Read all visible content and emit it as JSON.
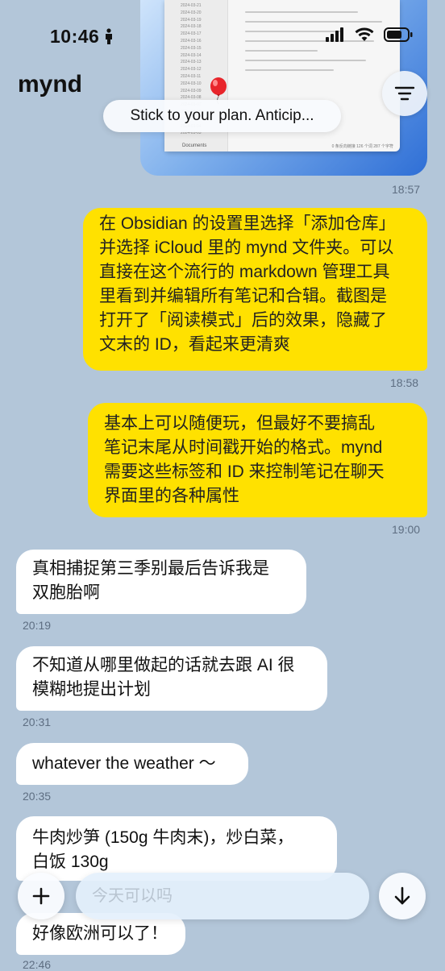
{
  "status_bar": {
    "time": "10:46"
  },
  "header": {
    "title": "mynd"
  },
  "image_message": {
    "tip": "Stick to your plan. Anticip...",
    "documents_label": "Documents",
    "footer_text": "0 条反向链接  126 个词  287 个字符",
    "sidebar_dates": [
      "2024-03-21",
      "2024-03-20",
      "2024-03-19",
      "2024-03-18",
      "2024-03-17",
      "2024-03-16",
      "2024-03-15",
      "2024-03-14",
      "2024-03-13",
      "2024-03-12",
      "2024-03-11",
      "2024-03-10",
      "2024-03-09",
      "2024-03-08",
      "2024-03-07",
      "2024-03-06",
      "2024-03-05",
      "2024-03-04",
      "2024-03-03"
    ],
    "time": "18:57"
  },
  "messages": [
    {
      "side": "me",
      "lines": [
        "在 Obsidian 的设置里选择「添加仓库」",
        "并选择 iCloud 里的 mynd 文件夹。可以",
        "直接在这个流行的 markdown 管理工具",
        "里看到并编辑所有笔记和合辑。截图是",
        "打开了「阅读模式」后的效果，隐藏了",
        "文末的 ID，看起来更清爽"
      ],
      "time": "18:58"
    },
    {
      "side": "me",
      "lines": [
        "基本上可以随便玩，但最好不要搞乱",
        "笔记末尾从时间戳开始的格式。mynd",
        "需要这些标签和 ID 来控制笔记在聊天",
        "界面里的各种属性"
      ],
      "time": "19:00"
    },
    {
      "side": "other",
      "lines": [
        "真相捕捉第三季别最后告诉我是",
        "双胞胎啊"
      ],
      "time": "20:19"
    },
    {
      "side": "other",
      "lines": [
        "不知道从哪里做起的话就去跟 AI 很",
        "模糊地提出计划"
      ],
      "time": "20:31"
    },
    {
      "side": "other",
      "lines": [
        "whatever the weather ～"
      ],
      "time": "20:35"
    },
    {
      "side": "other",
      "lines": [
        "牛肉炒笋 (150g 牛肉末)，炒白菜，",
        "白饭 130g"
      ],
      "time": ""
    },
    {
      "side": "other",
      "lines": [
        "好像欧洲可以了！"
      ],
      "time": "22:46"
    }
  ],
  "composer": {
    "placeholder": "今天可以吗"
  },
  "icons": {
    "menu": "filter-lines-icon",
    "plus": "plus-icon",
    "down": "arrow-down-icon"
  },
  "colors": {
    "background": "#b3c6d9",
    "my_bubble": "#ffe100",
    "other_bubble": "#ffffff"
  }
}
